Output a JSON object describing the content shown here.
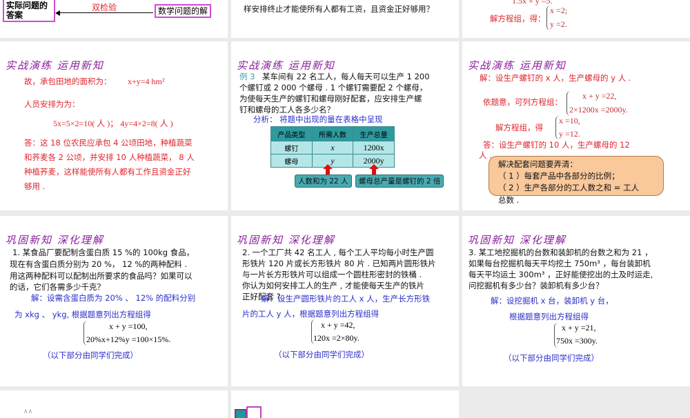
{
  "slides": {
    "s1": {
      "box_left": "实际问题的答案",
      "check": "双检验",
      "box_right": "数学问题的解"
    },
    "s2": {
      "line": "样安排终止才能使所有人都有工资，且资金正好够用？"
    },
    "s3": {
      "eq_top": "1.5x + y =5.",
      "solve": "解方程组，得：",
      "x": "x =2;",
      "y": "y =2."
    },
    "s4": {
      "title": "实战演练 运用新知",
      "l1": "故，承包田地的面积为：",
      "l1b": "x+y=4 hm²",
      "l2": "人员安排为为：",
      "l3": "5x=5×2=10( 人 )；  4y=4×2=8( 人 )",
      "ans": [
        "答：这 18 位农民应承包 4 公顷田地，种植蔬菜",
        "和荞麦各 2 公顷，并安排 10 人种植蔬菜， 8 人",
        "种植荞麦，这样能使所有人都有工作且资金正好",
        "够用 ."
      ]
    },
    "s5": {
      "title": "实战演练 运用新知",
      "ex": "例 3",
      "q": [
        "某车间有 22 名工人，每人每天可以生产 1 200",
        "个螺钉或 2 000 个螺母 . 1 个螺钉需要配  2 个螺母，",
        "为使每天生产的螺钉和螺母刚好配套，应安排生产螺",
        "钉和螺母的工人各多少名？"
      ],
      "analysis": "分析：  将题中出现的量在表格中呈现",
      "table": {
        "headers": [
          "产品类型",
          "所需人数",
          "生产总量"
        ],
        "rows": [
          [
            "螺钉",
            "x",
            "1200x"
          ],
          [
            "螺母",
            "y",
            "2000y"
          ]
        ]
      },
      "callout1": "人数和为 22 人",
      "callout2": "螺母总产量是螺钉的 2 倍"
    },
    "s6": {
      "title": "实战演练 运用新知",
      "l1": "解：设生产螺钉的 x 人，生产螺母的 y 人 .",
      "l2": "依题意，可列方程组：",
      "e1": "x + y =22,",
      "e2": "2×1200x =2000y.",
      "l3": "解方程组，得",
      "r1": "x =10,",
      "r2": "y =12.",
      "ans1": "答：设生产螺钉的 10 人，生产螺母的 12",
      "ans2": "人 .",
      "note": [
        "解决配套问题要弄清：",
        "（ 1 ）每套产品中各部分的比例；",
        "（ 2 ）生产各部分的工人数之和 = 工人"
      ],
      "note_over": "总数 ."
    },
    "s7": {
      "title": "巩固新知 深化理解",
      "q": [
        "1. 某食品厂要配制含蛋白质 15 %的 100kg 食品，",
        "现在有含蛋白质分别为 20 %， 12 %的两种配料 .",
        "用这两种配料可以配制出所要求的食品吗？如果可以",
        "的话，它们各需多少千克？"
      ],
      "s1": "解：设需含蛋白质为 20% 、 12% 的配料分别",
      "s2": "为 xkg 、 ykg, 根据题意列出方程组得",
      "e1": "x + y =100,",
      "e2": "20%x+12%y =100×15%.",
      "rest": "（以下部分由同学们完成）"
    },
    "s8": {
      "title": "巩固新知 深化理解",
      "q": [
        "2. 一个工厂共 42 名工人 , 每个工人平均每小时生产圆",
        "形铁片 120 片或长方形铁片 80 片 . 已知两片圆形铁片",
        "与一片长方形铁片可以组成一个圆柱形密封的铁桶 .",
        "你认为如何安排工人的生产 , 才能使每天生产的铁片",
        "正好配套 ?"
      ],
      "s1": "解：设生产圆形铁片的工人 x 人，生产长方形铁",
      "s2": "片的工人 y 人，根据题意列出方程组得",
      "e1": "x + y =42,",
      "e2": "120x =2×80y.",
      "rest": "（以下部分由同学们完成）"
    },
    "s9": {
      "title": "巩固新知 深化理解",
      "q": [
        "3. 某工地挖掘机的台数和装卸机的台数之和为 21 ，",
        "如果每台挖掘机每天平均挖土 750m³ ，每台装卸机",
        "每天平均运土 300m³ ，正好能使挖出的土及时运走,",
        "问挖掘机有多少台？装卸机有多少台？"
      ],
      "s1": "解：设挖掘机 x 台，装卸机 y 台，",
      "s2": "根据题意列出方程组得",
      "e1": "x + y =21,",
      "e2": "750x =300y.",
      "rest": "（以下部分由同学们完成）"
    }
  },
  "colors": {
    "red": "#e0242c",
    "blue": "#2a2fc8",
    "title": "#8a1f9e",
    "teal": "#2e9a9e",
    "note": "#f9c89b"
  }
}
